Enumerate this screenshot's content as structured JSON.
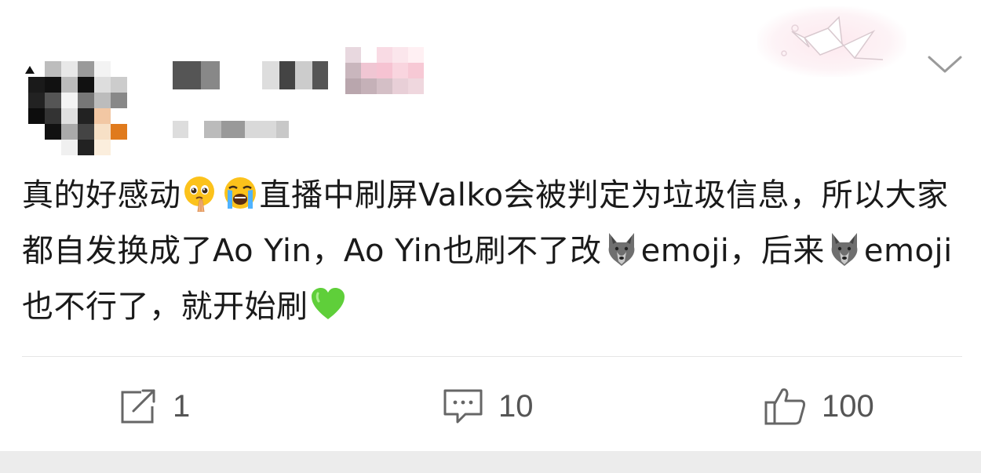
{
  "post": {
    "segments": [
      {
        "type": "text",
        "value": "真的好感动"
      },
      {
        "type": "emoji",
        "icon": "pleading-hands-emoji"
      },
      {
        "type": "emoji",
        "icon": "crying-face-emoji"
      },
      {
        "type": "text",
        "value": "直播中刷屏Valko会被判定为垃圾信息，所以大家都自发换成了Ao Yin，Ao Yin也刷不了改"
      },
      {
        "type": "emoji",
        "icon": "wolf-emoji"
      },
      {
        "type": "text",
        "value": "emoji，后来"
      },
      {
        "type": "emoji",
        "icon": "wolf-emoji"
      },
      {
        "type": "text",
        "value": "emoji也不行了，就开始刷"
      },
      {
        "type": "emoji",
        "icon": "green-heart-emoji"
      }
    ],
    "text_part_1": "真的好感动",
    "text_part_2": "直播中刷屏Valko会被判定为垃圾信息，所以大家都自发换成了Ao Yin，Ao Yin也刷不了改",
    "text_part_3": "emoji，后来",
    "text_part_4": "emoji也不行了，就开始刷"
  },
  "actions": {
    "repost_count": "1",
    "comment_count": "10",
    "like_count": "100"
  },
  "icons": {
    "repost": "share-square-icon",
    "comment": "comment-bubble-icon",
    "like": "thumbs-up-icon",
    "more": "chevron-down-icon",
    "badge": "paper-crane-icon"
  },
  "colors": {
    "text": "#1a1a1a",
    "muted": "#555555",
    "divider": "#e6e6e6",
    "strip": "#ececec",
    "green_heart": "#5fcf3a"
  }
}
